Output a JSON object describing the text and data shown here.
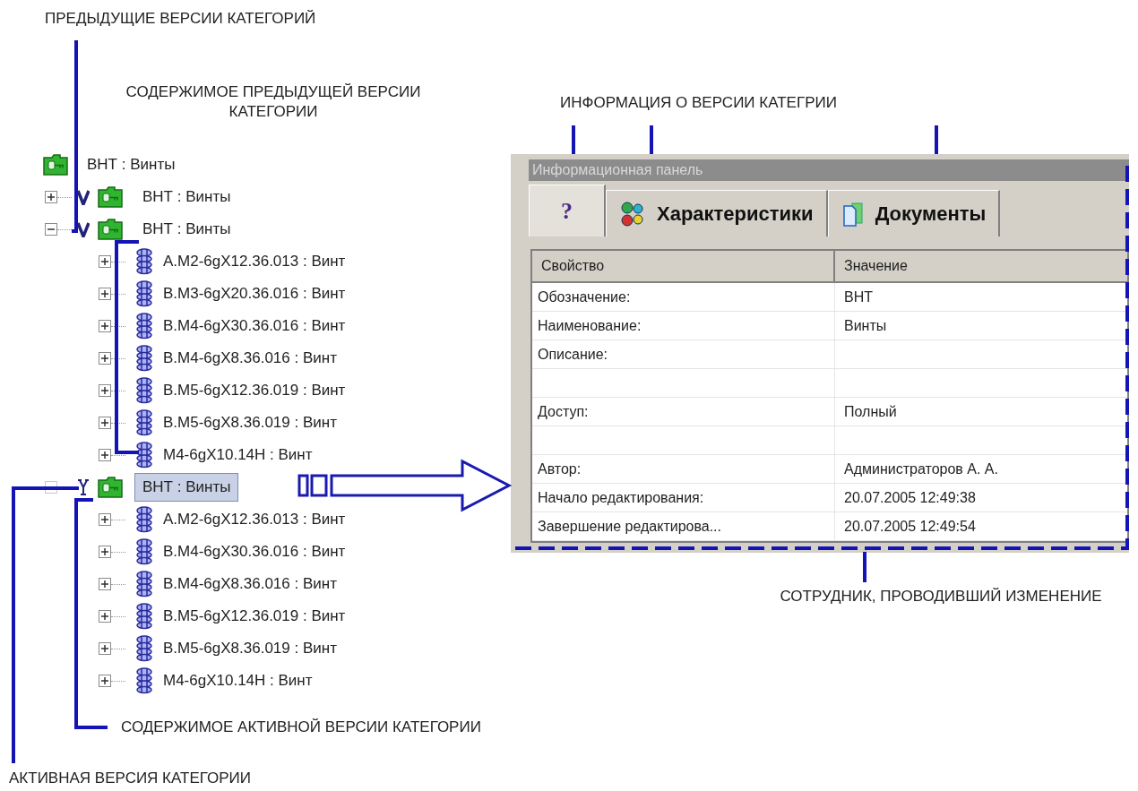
{
  "annotations": [
    {
      "text": "ПРЕДЫДУЩИЕ ВЕРСИИ КАТЕГОРИЙ"
    },
    {
      "text": "СОДЕРЖИМОЕ ПРЕДЫДУЩЕЙ ВЕРСИИ КАТЕГОРИИ"
    },
    {
      "text": "ИНФОРМАЦИЯ О ВЕРСИИ КАТЕГРИИ"
    },
    {
      "text": "СОТРУДНИК, ПРОВОДИВШИЙ ИЗМЕНЕНИЕ"
    },
    {
      "text": "СОДЕРЖИМОЕ АКТИВНОЙ ВЕРСИИ КАТЕГОРИИ"
    },
    {
      "text": "АКТИВНАЯ ВЕРСИЯ КАТЕГОРИИ"
    }
  ],
  "tree": {
    "label": "ВНТ : Винты",
    "children": [
      {
        "kind": "version",
        "label": "ВНТ : Винты",
        "expanded": false,
        "selected": false
      },
      {
        "kind": "version",
        "label": "ВНТ : Винты",
        "expanded": true,
        "selected": false,
        "children": [
          {
            "label": "А.М2-6gX12.36.013 : Винт",
            "expanded": false
          },
          {
            "label": "В.М3-6gX20.36.016 : Винт",
            "expanded": false
          },
          {
            "label": "В.М4-6gX30.36.016 : Винт",
            "expanded": false
          },
          {
            "label": "В.М4-6gX8.36.016 : Винт",
            "expanded": false
          },
          {
            "label": "В.М5-6gX12.36.019 : Винт",
            "expanded": false
          },
          {
            "label": "В.М5-6gX8.36.019 : Винт",
            "expanded": false
          },
          {
            "label": "М4-6gX10.14Н : Винт",
            "expanded": false
          }
        ]
      },
      {
        "kind": "active_version",
        "label": "ВНТ : Винты",
        "expanded": true,
        "selected": true,
        "children": [
          {
            "label": "А.М2-6gX12.36.013 : Винт",
            "expanded": false
          },
          {
            "label": "В.М4-6gX30.36.016 : Винт",
            "expanded": false
          },
          {
            "label": "В.М4-6gX8.36.016 : Винт",
            "expanded": false
          },
          {
            "label": "В.М5-6gX12.36.019 : Винт",
            "expanded": false
          },
          {
            "label": "В.М5-6gX8.36.019 : Винт",
            "expanded": false
          },
          {
            "label": "М4-6gX10.14Н : Винт",
            "expanded": false
          }
        ]
      }
    ]
  },
  "info_panel": {
    "title": "Информационная панель",
    "tabs": [
      {
        "kind": "help",
        "label": "?",
        "selected": true
      },
      {
        "kind": "features",
        "label": "Характеристики",
        "selected": false
      },
      {
        "kind": "documents",
        "label": "Документы",
        "selected": false
      }
    ],
    "table": {
      "columns": [
        "Свойство",
        "Значение"
      ],
      "rows": [
        {
          "kind": "field",
          "property": "Обозначение:",
          "value": "ВНТ"
        },
        {
          "kind": "field",
          "property": "Наименование:",
          "value": "Винты"
        },
        {
          "kind": "field",
          "property": "Описание:"
        },
        {
          "kind": "blank"
        },
        {
          "kind": "field",
          "property": "Доступ:",
          "value": "Полный"
        },
        {
          "kind": "blank"
        },
        {
          "kind": "field",
          "property": "Автор:",
          "value": "Администраторов А. А."
        },
        {
          "kind": "field",
          "property": "Начало редактирования:",
          "value": "20.07.2005  12:49:38"
        },
        {
          "kind": "field",
          "property": "Завершение редактирова...",
          "value": "20.07.2005  12:49:54"
        }
      ]
    }
  }
}
